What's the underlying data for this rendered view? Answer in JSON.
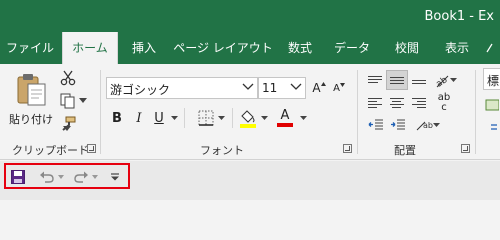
{
  "window": {
    "title": "Book1  -  Ex"
  },
  "tabs": [
    {
      "label": "ファイル",
      "active": false
    },
    {
      "label": "ホーム",
      "active": true
    },
    {
      "label": "挿入",
      "active": false
    },
    {
      "label": "ページ レイアウト",
      "active": false
    },
    {
      "label": "数式",
      "active": false
    },
    {
      "label": "データ",
      "active": false
    },
    {
      "label": "校閲",
      "active": false
    },
    {
      "label": "表示",
      "active": false
    }
  ],
  "clipboard": {
    "paste_label": "貼り付け",
    "group_label": "クリップボード"
  },
  "font": {
    "font_name": "游ゴシック",
    "font_size": "11",
    "bold_label": "B",
    "italic_label": "I",
    "underline_label": "U",
    "grow_label": "A",
    "shrink_label": "A",
    "font_color_label": "A",
    "group_label": "フォント",
    "fill_color": "#ffff00",
    "font_color": "#e00000"
  },
  "alignment": {
    "group_label": "配置",
    "wrap_label": "ab",
    "wrap_label2": "c"
  },
  "number": {
    "format_value": "標"
  },
  "qat": {
    "items": [
      "save-icon",
      "undo-icon",
      "redo-icon",
      "customize-icon"
    ]
  },
  "colors": {
    "accent": "#217346",
    "highlight": "#e6000f"
  }
}
